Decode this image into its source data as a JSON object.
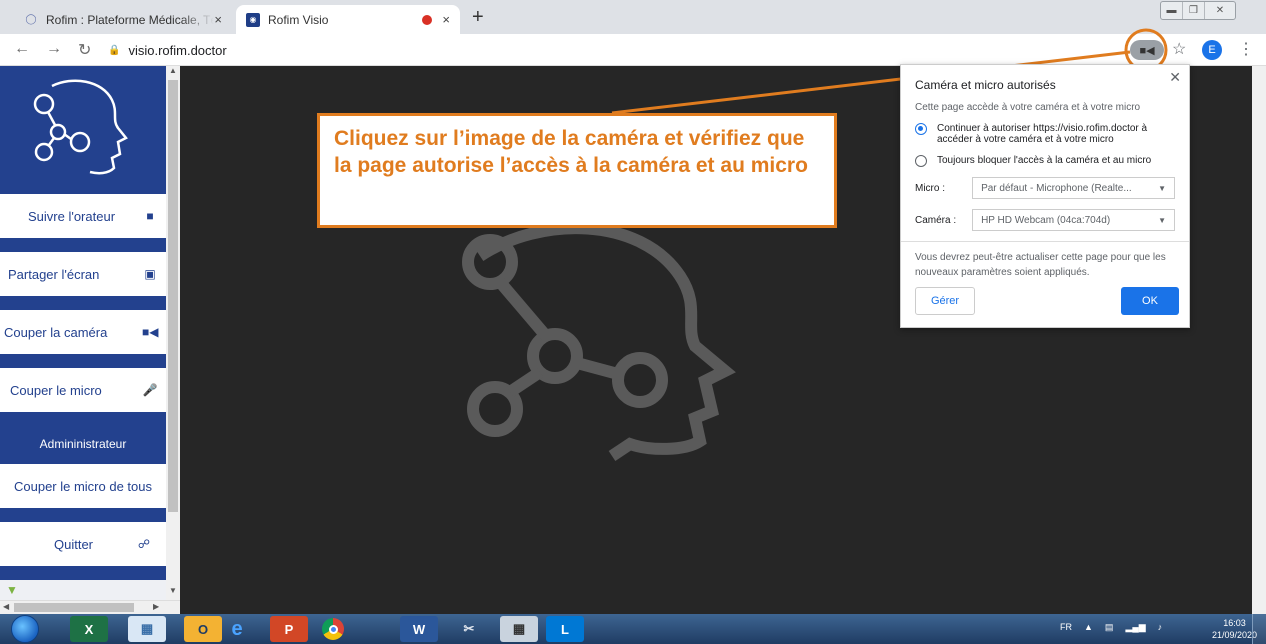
{
  "browser": {
    "tabs": [
      {
        "title": "Rofim : Plateforme Médicale, Télé",
        "close": "×"
      },
      {
        "title": "Rofim Visio",
        "close": "×"
      }
    ],
    "new_tab": "+",
    "url": "visio.rofim.doctor",
    "avatar_letter": "E"
  },
  "sidebar": {
    "items": [
      {
        "label": "Suivre l'orateur",
        "icon": "follow-speaker-icon"
      },
      {
        "label": "Partager l'écran",
        "icon": "share-screen-icon"
      },
      {
        "label": "Couper la caméra",
        "icon": "camera-icon"
      },
      {
        "label": "Couper le micro",
        "icon": "microphone-icon"
      },
      {
        "label": "Couper le micro de tous",
        "icon": ""
      },
      {
        "label": "Quitter",
        "icon": "hangup-icon"
      }
    ],
    "admin_label": "Admininistrateur",
    "accent_color": "#23418e"
  },
  "annotation": {
    "text": "Cliquez sur l’image de la caméra et vérifiez que la page autorise l’accès à la caméra et au micro",
    "color": "#e07c1f"
  },
  "popup": {
    "title": "Caméra et micro autorisés",
    "subtitle": "Cette page accède à votre caméra et à votre micro",
    "option_allow": "Continuer à autoriser https://visio.rofim.doctor à accéder à votre caméra et à votre micro",
    "option_block": "Toujours bloquer l'accès à la caméra et au micro",
    "mic_label": "Micro :",
    "mic_value": "Par défaut - Microphone (Realte...",
    "camera_label": "Caméra :",
    "camera_value": "HP HD Webcam (04ca:704d)",
    "note": "Vous devrez peut-être actualiser cette page pour que les nouveaux paramètres soient appliqués.",
    "manage_label": "Gérer",
    "ok_label": "OK"
  },
  "taskbar": {
    "language": "FR",
    "time": "16:03",
    "date": "21/09/2020"
  }
}
